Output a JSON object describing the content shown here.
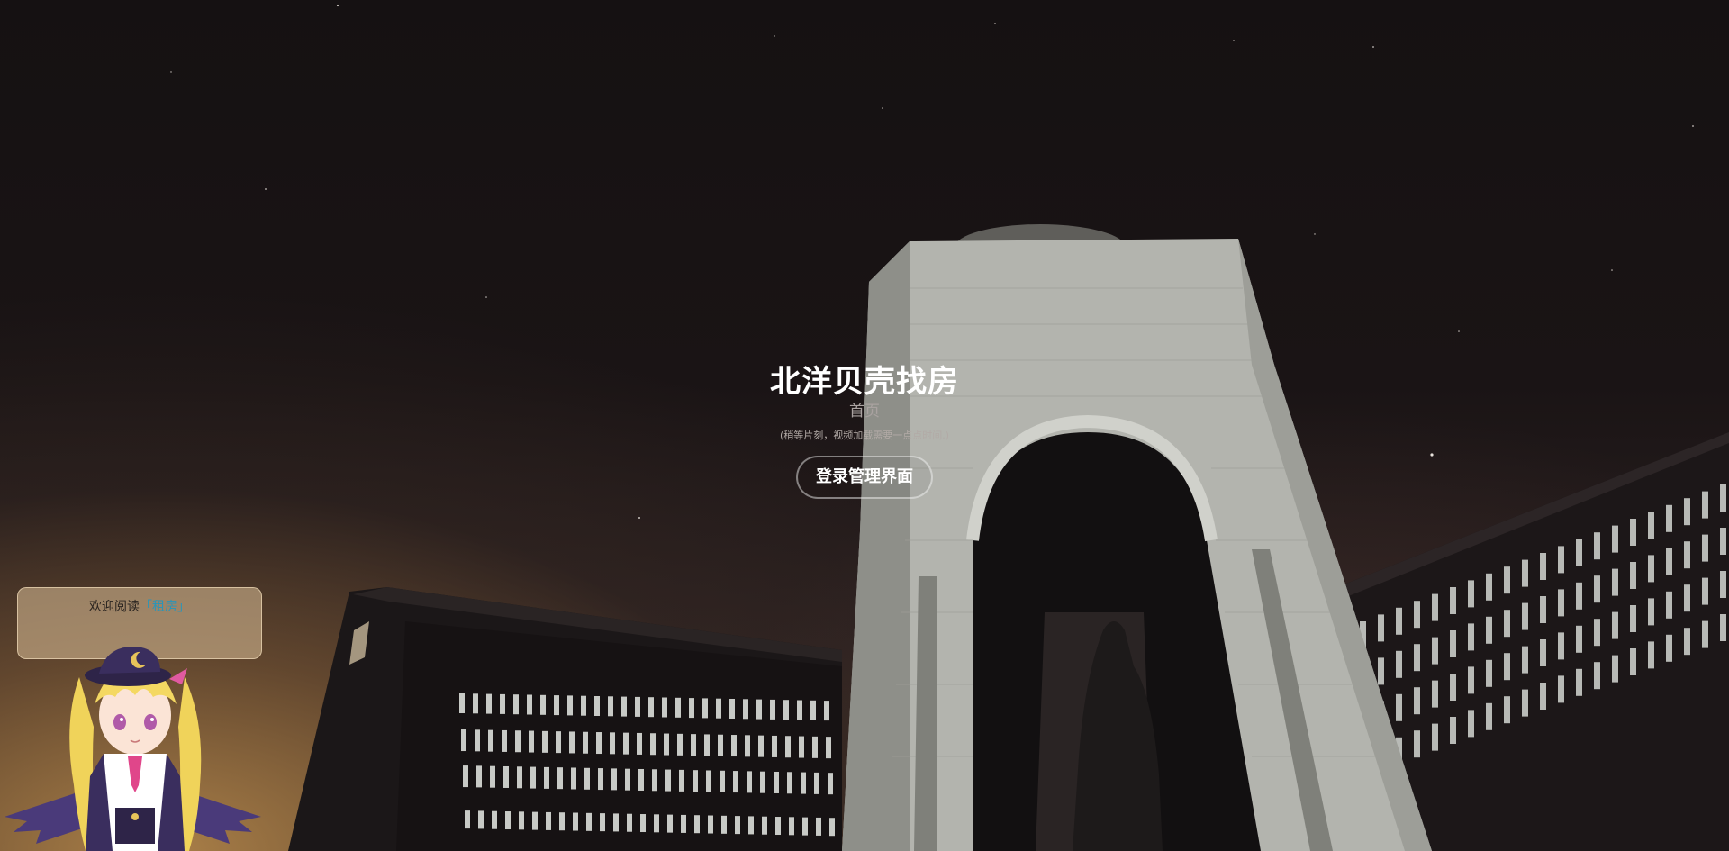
{
  "hero": {
    "title": "北洋贝壳找房",
    "subtitle": "首页",
    "note": "(稍等片刻，视频加载需要一点点时间.)",
    "login_label": "登录管理界面"
  },
  "mascot": {
    "greeting_prefix": "欢迎阅读",
    "greeting_highlight": "「租房」"
  },
  "colors": {
    "sky": "#151112",
    "glow": "#b0844a",
    "building": "#1e1a1b",
    "monument": "#b7b9b2",
    "accent": "#2b95b8"
  },
  "icons": [
    "mascot-character-icon"
  ]
}
